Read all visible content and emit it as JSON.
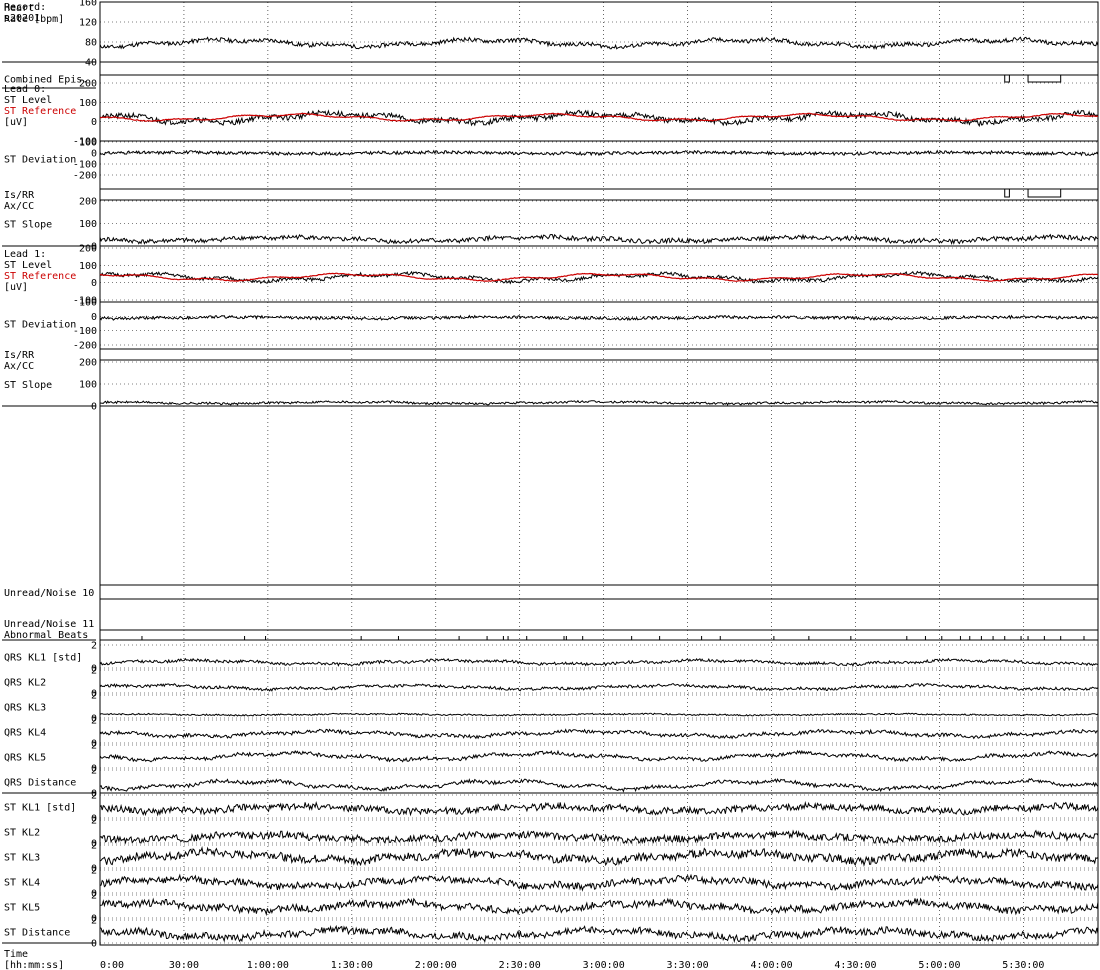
{
  "record": {
    "label": "Record:",
    "id": "s20201"
  },
  "time_axis": {
    "title_lines": [
      "Time",
      "[hh:mm:ss]"
    ],
    "ticks": [
      "0:00",
      "30:00",
      "1:00:00",
      "1:30:00",
      "2:00:00",
      "2:30:00",
      "3:00:00",
      "3:30:00",
      "4:00:00",
      "4:30:00",
      "5:00:00",
      "5:30:00"
    ],
    "tick_seconds": [
      0,
      1800,
      3600,
      5400,
      7200,
      9000,
      10800,
      12600,
      14400,
      16200,
      18000,
      19800
    ],
    "range_seconds": [
      0,
      21400
    ]
  },
  "colors": {
    "trace": "#000000",
    "reference": "#cc0000",
    "grid": "#000000",
    "background": "#ffffff"
  },
  "chart_data": {
    "type": "line",
    "x_unit": "seconds",
    "panels": [
      {
        "id": "heart_rate",
        "labels": [
          "Heart",
          "Rate [bpm]"
        ],
        "yticks": [
          "160",
          "120",
          "80",
          "40"
        ],
        "ylim": [
          40,
          160
        ],
        "series": [
          {
            "color": "#000000",
            "base": 78,
            "amp": 6,
            "noise": 4,
            "seed": 11
          }
        ]
      },
      {
        "id": "combined_epis",
        "labels": [
          "Combined Epis."
        ],
        "episodes": [
          [
            19400,
            19500
          ],
          [
            19900,
            20600
          ]
        ]
      },
      {
        "id": "lead0_st_level",
        "labels": [
          "Lead 0:",
          "ST Level",
          "ST Reference",
          "[uV]"
        ],
        "red_label_index": 2,
        "yticks": [
          "200",
          "100",
          "0",
          "-100"
        ],
        "ylim": [
          -100,
          200
        ],
        "series": [
          {
            "color": "#000000",
            "base": 20,
            "amp": 20,
            "noise": 14,
            "seed": 21
          },
          {
            "color": "#cc0000",
            "base": 22,
            "amp": 14,
            "noise": 2,
            "seed": 22
          }
        ]
      },
      {
        "id": "lead0_st_deviation",
        "labels": [
          "ST Deviation"
        ],
        "yticks": [
          "100",
          "0",
          "-100",
          "-200"
        ],
        "ylim": [
          -200,
          100
        ],
        "series": [
          {
            "color": "#000000",
            "base": 0,
            "amp": 6,
            "noise": 14,
            "seed": 31
          }
        ]
      },
      {
        "id": "lead0_isrr",
        "labels": [
          "Is/RR",
          "Ax/CC"
        ],
        "episodes": [
          [
            19400,
            19500
          ],
          [
            19900,
            20600
          ]
        ]
      },
      {
        "id": "lead0_st_slope",
        "labels": [
          "ST Slope"
        ],
        "yticks": [
          "200",
          "100",
          "0"
        ],
        "ylim": [
          0,
          200
        ],
        "series": [
          {
            "color": "#000000",
            "base": 30,
            "amp": 8,
            "noise": 10,
            "seed": 41
          }
        ]
      },
      {
        "id": "lead1_st_level",
        "labels": [
          "Lead 1:",
          "ST Level",
          "ST Reference",
          "[uV]"
        ],
        "red_label_index": 2,
        "yticks": [
          "200",
          "100",
          "0",
          "-100"
        ],
        "ylim": [
          -100,
          200
        ],
        "series": [
          {
            "color": "#000000",
            "base": 30,
            "amp": 18,
            "noise": 10,
            "seed": 51
          },
          {
            "color": "#cc0000",
            "base": 32,
            "amp": 16,
            "noise": 2,
            "seed": 52
          }
        ]
      },
      {
        "id": "lead1_st_deviation",
        "labels": [
          "ST Deviation"
        ],
        "yticks": [
          "100",
          "0",
          "-100",
          "-200"
        ],
        "ylim": [
          -200,
          100
        ],
        "series": [
          {
            "color": "#000000",
            "base": -10,
            "amp": 5,
            "noise": 10,
            "seed": 61
          }
        ]
      },
      {
        "id": "lead1_isrr",
        "labels": [
          "Is/RR",
          "Ax/CC"
        ],
        "episodes": []
      },
      {
        "id": "lead1_st_slope",
        "labels": [
          "ST Slope"
        ],
        "yticks": [
          "200",
          "100",
          "0"
        ],
        "ylim": [
          0,
          200
        ],
        "series": [
          {
            "color": "#000000",
            "base": 15,
            "amp": 4,
            "noise": 5,
            "seed": 71
          }
        ]
      },
      {
        "id": "blank",
        "labels": []
      },
      {
        "id": "unread_noise_10",
        "labels": [
          "Unread/Noise 10"
        ]
      },
      {
        "id": "unread_noise_11",
        "labels": [
          "Unread/Noise 11"
        ]
      },
      {
        "id": "abnormal_beats",
        "labels": [
          "Abnormal Beats"
        ],
        "beat_seconds": [
          900,
          3100,
          3550,
          5600,
          6400,
          7700,
          8300,
          8650,
          8750,
          9150,
          9950,
          10000,
          10350,
          11400,
          12000,
          12900,
          13300,
          14450,
          15200,
          16100,
          17300,
          17700,
          18050,
          18450,
          18650,
          18900,
          19150,
          19400,
          19750,
          19900,
          20250,
          20600,
          21100
        ]
      },
      {
        "id": "qrs_kl1",
        "labels": [
          "QRS KL1 [std]"
        ],
        "yticks": [
          "2",
          "0"
        ],
        "ylim": [
          0,
          2
        ],
        "series": [
          {
            "color": "#000000",
            "base": 0.5,
            "amp": 0.15,
            "noise": 0.12,
            "seed": 81
          }
        ]
      },
      {
        "id": "qrs_kl2",
        "labels": [
          "QRS KL2"
        ],
        "yticks": [
          "2",
          "0"
        ],
        "ylim": [
          0,
          2
        ],
        "series": [
          {
            "color": "#000000",
            "base": 0.5,
            "amp": 0.15,
            "noise": 0.12,
            "seed": 82
          }
        ]
      },
      {
        "id": "qrs_kl3",
        "labels": [
          "QRS KL3"
        ],
        "yticks": [
          "2",
          "0"
        ],
        "ylim": [
          0,
          2
        ],
        "series": [
          {
            "color": "#000000",
            "base": 0.3,
            "amp": 0.05,
            "noise": 0.06,
            "seed": 83
          }
        ]
      },
      {
        "id": "qrs_kl4",
        "labels": [
          "QRS KL4"
        ],
        "yticks": [
          "2",
          "0"
        ],
        "ylim": [
          0,
          2
        ],
        "series": [
          {
            "color": "#000000",
            "base": 0.8,
            "amp": 0.2,
            "noise": 0.15,
            "seed": 84
          }
        ]
      },
      {
        "id": "qrs_kl5",
        "labels": [
          "QRS KL5"
        ],
        "yticks": [
          "2",
          "0"
        ],
        "ylim": [
          0,
          2
        ],
        "series": [
          {
            "color": "#000000",
            "base": 1.0,
            "amp": 0.25,
            "noise": 0.15,
            "seed": 85
          }
        ]
      },
      {
        "id": "qrs_distance",
        "labels": [
          "QRS Distance"
        ],
        "yticks": [
          "2",
          "0"
        ],
        "ylim": [
          0,
          2
        ],
        "series": [
          {
            "color": "#000000",
            "base": 0.7,
            "amp": 0.3,
            "noise": 0.15,
            "seed": 86
          }
        ]
      },
      {
        "id": "st_kl1",
        "labels": [
          "ST KL1 [std]"
        ],
        "yticks": [
          "2",
          "0"
        ],
        "ylim": [
          0,
          2
        ],
        "series": [
          {
            "color": "#000000",
            "base": 0.8,
            "amp": 0.2,
            "noise": 0.3,
            "seed": 91
          }
        ]
      },
      {
        "id": "st_kl2",
        "labels": [
          "ST KL2"
        ],
        "yticks": [
          "2",
          "0"
        ],
        "ylim": [
          0,
          2
        ],
        "series": [
          {
            "color": "#000000",
            "base": 0.5,
            "amp": 0.2,
            "noise": 0.3,
            "seed": 92
          }
        ]
      },
      {
        "id": "st_kl3",
        "labels": [
          "ST KL3"
        ],
        "yticks": [
          "2",
          "0"
        ],
        "ylim": [
          0,
          2
        ],
        "series": [
          {
            "color": "#000000",
            "base": 1.0,
            "amp": 0.3,
            "noise": 0.35,
            "seed": 93
          }
        ]
      },
      {
        "id": "st_kl4",
        "labels": [
          "ST KL4"
        ],
        "yticks": [
          "2",
          "0"
        ],
        "ylim": [
          0,
          2
        ],
        "series": [
          {
            "color": "#000000",
            "base": 0.9,
            "amp": 0.3,
            "noise": 0.3,
            "seed": 94
          }
        ]
      },
      {
        "id": "st_kl5",
        "labels": [
          "ST KL5"
        ],
        "yticks": [
          "2",
          "0"
        ],
        "ylim": [
          0,
          2
        ],
        "series": [
          {
            "color": "#000000",
            "base": 1.0,
            "amp": 0.3,
            "noise": 0.3,
            "seed": 95
          }
        ]
      },
      {
        "id": "st_distance",
        "labels": [
          "ST Distance"
        ],
        "yticks": [
          "2",
          "0"
        ],
        "ylim": [
          0,
          2
        ],
        "series": [
          {
            "color": "#000000",
            "base": 0.8,
            "amp": 0.3,
            "noise": 0.3,
            "seed": 96
          }
        ]
      }
    ]
  }
}
